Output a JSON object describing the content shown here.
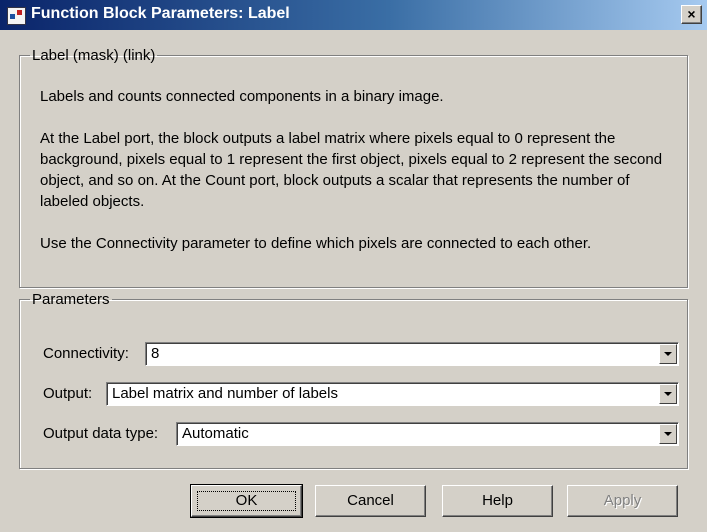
{
  "window": {
    "title": "Function Block Parameters: Label",
    "icon": "simulink-block-icon",
    "close_label": "×"
  },
  "description": {
    "legend": "Label (mask) (link)",
    "paragraphs": [
      "Labels and counts connected components in a binary image.",
      "At the Label port, the block outputs a label matrix where pixels equal to 0 represent the background, pixels equal to 1 represent the first object, pixels equal to 2 represent the second object, and so on.  At the Count port, block outputs a scalar that represents the number of labeled objects.",
      "Use the Connectivity parameter to define which pixels are connected to each other."
    ]
  },
  "parameters": {
    "legend": "Parameters",
    "connectivity": {
      "label": "Connectivity:",
      "value": "8"
    },
    "output": {
      "label": "Output:",
      "value": "Label matrix and number of labels"
    },
    "output_data_type": {
      "label": "Output data type:",
      "value": "Automatic"
    }
  },
  "buttons": {
    "ok": "OK",
    "cancel": "Cancel",
    "help": "Help",
    "apply": "Apply"
  }
}
